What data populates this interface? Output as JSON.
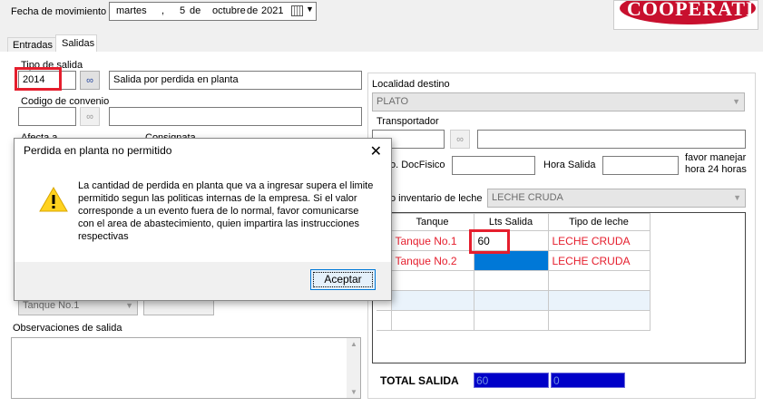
{
  "header": {
    "fecha_label": "Fecha de movimiento",
    "date": {
      "weekday": "martes",
      "day": "5",
      "sep": "de",
      "month": "octubre",
      "sep2": "de",
      "year": "2021"
    },
    "logo_text": "COOPERATIVA"
  },
  "tabs": [
    {
      "label": "Entradas"
    },
    {
      "label": "Salidas"
    }
  ],
  "left": {
    "tipo_salida_label": "Tipo de salida",
    "tipo_salida_code": "2014",
    "tipo_salida_desc": "Salida por perdida en planta",
    "codigo_convenio_label": "Codigo de convenio",
    "codigo_convenio_value": "",
    "codigo_convenio_desc": "",
    "afecta_label": "Afecta a",
    "consignata_label": "Consignata",
    "tanque_combo": "Tanque No.1",
    "observaciones_label": "Observaciones de salida",
    "observaciones_value": ""
  },
  "right": {
    "localidad_label": "Localidad destino",
    "localidad_value": "PLATO",
    "transportador_label": "Transportador",
    "transportador_code": "",
    "transportador_desc": "",
    "docfisico_label": "o. DocFisico",
    "hora_salida_label": "Hora Salida",
    "hora_note_1": "favor manejar",
    "hora_note_2": "hora 24 horas",
    "inventario_label": "o inventario de leche",
    "inventario_value": "LECHE CRUDA",
    "table": {
      "headers": [
        "Tanque",
        "Lts Salida",
        "Tipo de leche"
      ],
      "rows": [
        {
          "tanque": "Tanque No.1",
          "lts": "60",
          "tipo": "LECHE CRUDA"
        },
        {
          "tanque": "Tanque No.2",
          "lts": "",
          "tipo": "LECHE CRUDA"
        },
        {
          "tanque": "",
          "lts": "",
          "tipo": ""
        },
        {
          "tanque": "",
          "lts": "",
          "tipo": ""
        },
        {
          "tanque": "",
          "lts": "",
          "tipo": ""
        }
      ]
    },
    "total_label": "TOTAL SALIDA",
    "total_value_1": "60",
    "total_value_2": "0"
  },
  "dialog": {
    "title": "Perdida en planta no permitido",
    "close_glyph": "✕",
    "message": "La cantidad de perdida en planta que va a ingresar supera el limite permitido segun las politicas internas de la empresa. Si el valor corresponde a un evento fuera de lo normal, favor comunicarse con el area de abastecimiento, quien impartira las instrucciones respectivas",
    "ok_label": "Aceptar",
    "icon": "warning-icon"
  },
  "colors": {
    "highlight": "#e51e2d",
    "selection": "#0078d7",
    "total_bg": "#0000c8"
  }
}
